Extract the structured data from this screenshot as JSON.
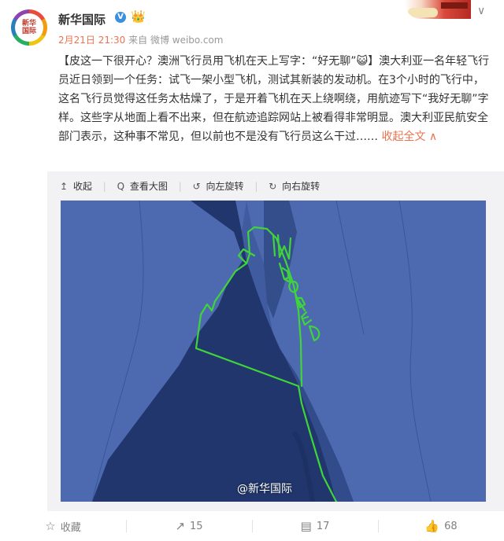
{
  "post": {
    "author": "新华国际",
    "avatar_text_line1": "新华",
    "avatar_text_line2": "国际",
    "verified_glyph": "V",
    "time": "2月21日 21:30",
    "source": "来自 微博 weibo.com",
    "text": "【皮这一下很开心？澳洲飞行员用飞机在天上写字：“好无聊”😺】澳大利亚一名年轻飞行员近日领到一个任务：试飞一架小型飞机，测试其新装的发动机。在3个小时的飞行中，这名飞行员觉得这任务太枯燥了，于是开着飞机在天上绕啊绕，用航迹写下“我好无聊”字样。这些字从地面上看不出来，但在航迹追踪网站上被看得非常明显。澳大利亚民航安全部门表示，这种事不常见，但以前也不是没有飞行员这么干过……",
    "collapse_label": "收起全文",
    "collapse_arrow": "∧"
  },
  "media_toolbar": {
    "collapse": "收起",
    "view_large": "查看大图",
    "rotate_left": "向左旋转",
    "rotate_right": "向右旋转"
  },
  "icons": {
    "collapse": "↥",
    "view_large": "Q",
    "rotate_left": "↺",
    "rotate_right": "↻",
    "favorite": "☆",
    "repost": "↗",
    "comment": "▤",
    "like": "👍",
    "dropdown": "∨",
    "crown": "👑"
  },
  "map_image": {
    "watermark": "@新华国际",
    "flight_text": "IM BORED",
    "colors": {
      "land": "#4d6ab0",
      "water": "#21366d",
      "track": "#3fd43a"
    }
  },
  "actions": {
    "favorite": "收藏",
    "repost": "15",
    "comment": "17",
    "like": "68"
  }
}
